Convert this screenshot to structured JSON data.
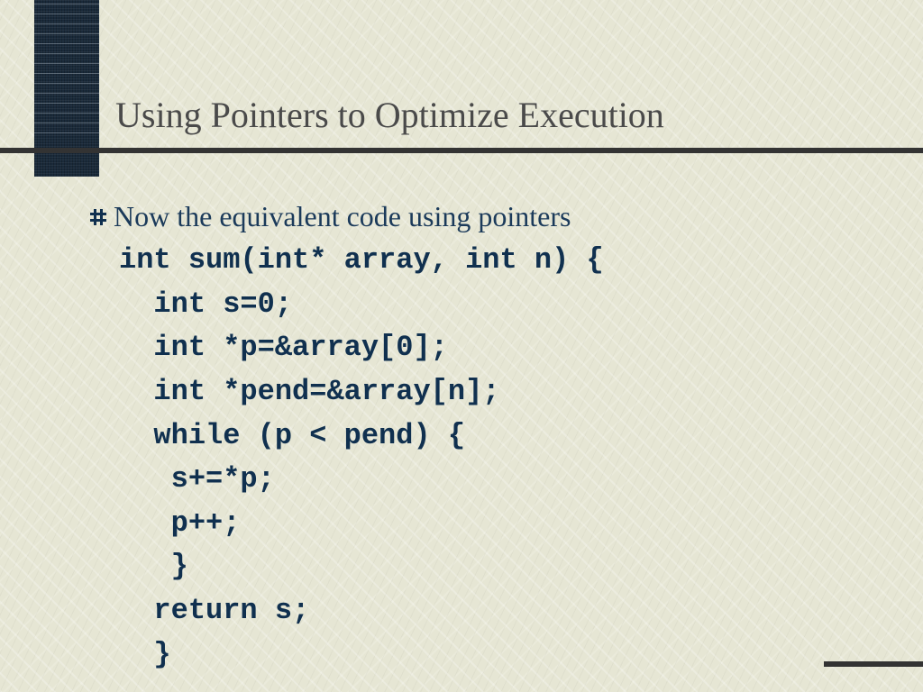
{
  "slide": {
    "title": "Using Pointers to Optimize Execution",
    "bullet": "Now the equivalent code using pointers",
    "code": "int sum(int* array, int n) {\n  int s=0;\n  int *p=&array[0];\n  int *pend=&array[n];\n  while (p < pend) {\n   s+=*p;\n   p++;\n   }\n  return s;\n  }"
  },
  "colors": {
    "background": "#e8e8d8",
    "title": "#4a4a4a",
    "body": "#1b3a5a",
    "code": "#10304f",
    "rule": "#333333",
    "corner": "#1a2a3a"
  }
}
